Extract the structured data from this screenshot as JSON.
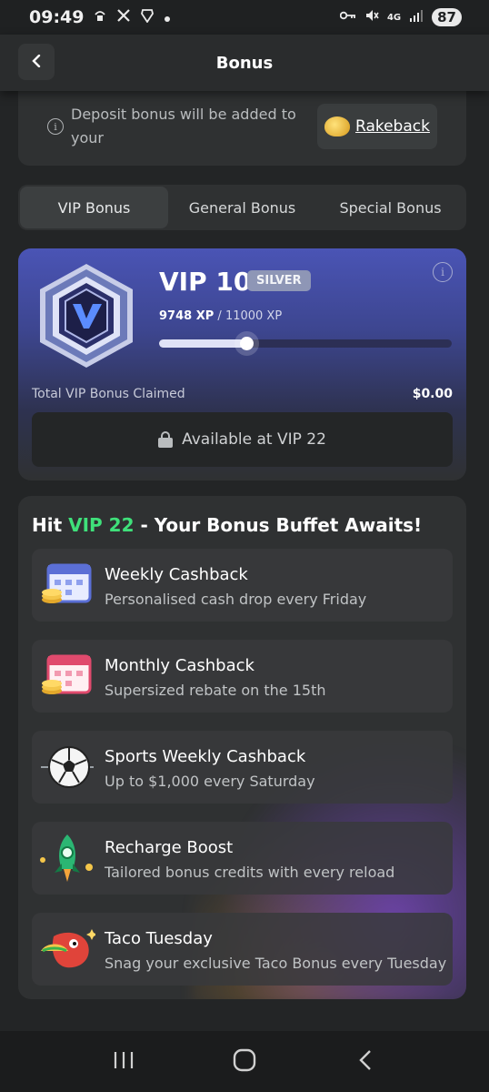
{
  "status_bar": {
    "time": "09:49",
    "network": "4G",
    "battery": "87",
    "icons": [
      "location-lock-icon",
      "x-icon",
      "brave-icon",
      "dot-icon",
      "key-icon",
      "mute-icon",
      "signal-icon"
    ]
  },
  "header": {
    "title": "Bonus",
    "back_icon": "chevron-left-icon"
  },
  "notice": {
    "text": "Deposit bonus will be added to your",
    "link_label": "Rakeback",
    "icon": "info-icon"
  },
  "tabs": [
    {
      "label": "VIP Bonus",
      "active": true
    },
    {
      "label": "General Bonus",
      "active": false
    },
    {
      "label": "Special Bonus",
      "active": false
    }
  ],
  "vip": {
    "level": "VIP 10",
    "tier": "SILVER",
    "xp_current": "9748 XP",
    "xp_separator": "/",
    "xp_target": "11000 XP",
    "progress": 0.3,
    "claimed_label": "Total VIP Bonus Claimed",
    "claimed_value": "$0.00",
    "locked_label": "Available at VIP 22",
    "colors": {
      "card_top": "#4a54b5",
      "progress_fill": "#dfe2f6"
    }
  },
  "buffet": {
    "title_prefix": "Hit",
    "title_highlight": "VIP 22",
    "title_suffix": "- Your Bonus Buffet Awaits!",
    "accent_color": "#3fe07a",
    "items": [
      {
        "name": "Weekly Cashback",
        "desc": "Personalised cash drop every Friday",
        "icon": "calendar-coins-icon"
      },
      {
        "name": "Monthly Cashback",
        "desc": "Supersized rebate on the 15th",
        "icon": "pink-calendar-coins-icon"
      },
      {
        "name": "Sports Weekly Cashback",
        "desc": "Up to $1,000 every Saturday",
        "icon": "soccer-ball-icon"
      },
      {
        "name": "Recharge Boost",
        "desc": "Tailored bonus credits with every reload",
        "icon": "rocket-icon"
      },
      {
        "name": "Taco Tuesday",
        "desc": "Snag your exclusive Taco Bonus every Tuesday",
        "icon": "taco-monster-icon"
      }
    ]
  },
  "nav": [
    "recent-apps-icon",
    "home-icon",
    "back-icon"
  ]
}
